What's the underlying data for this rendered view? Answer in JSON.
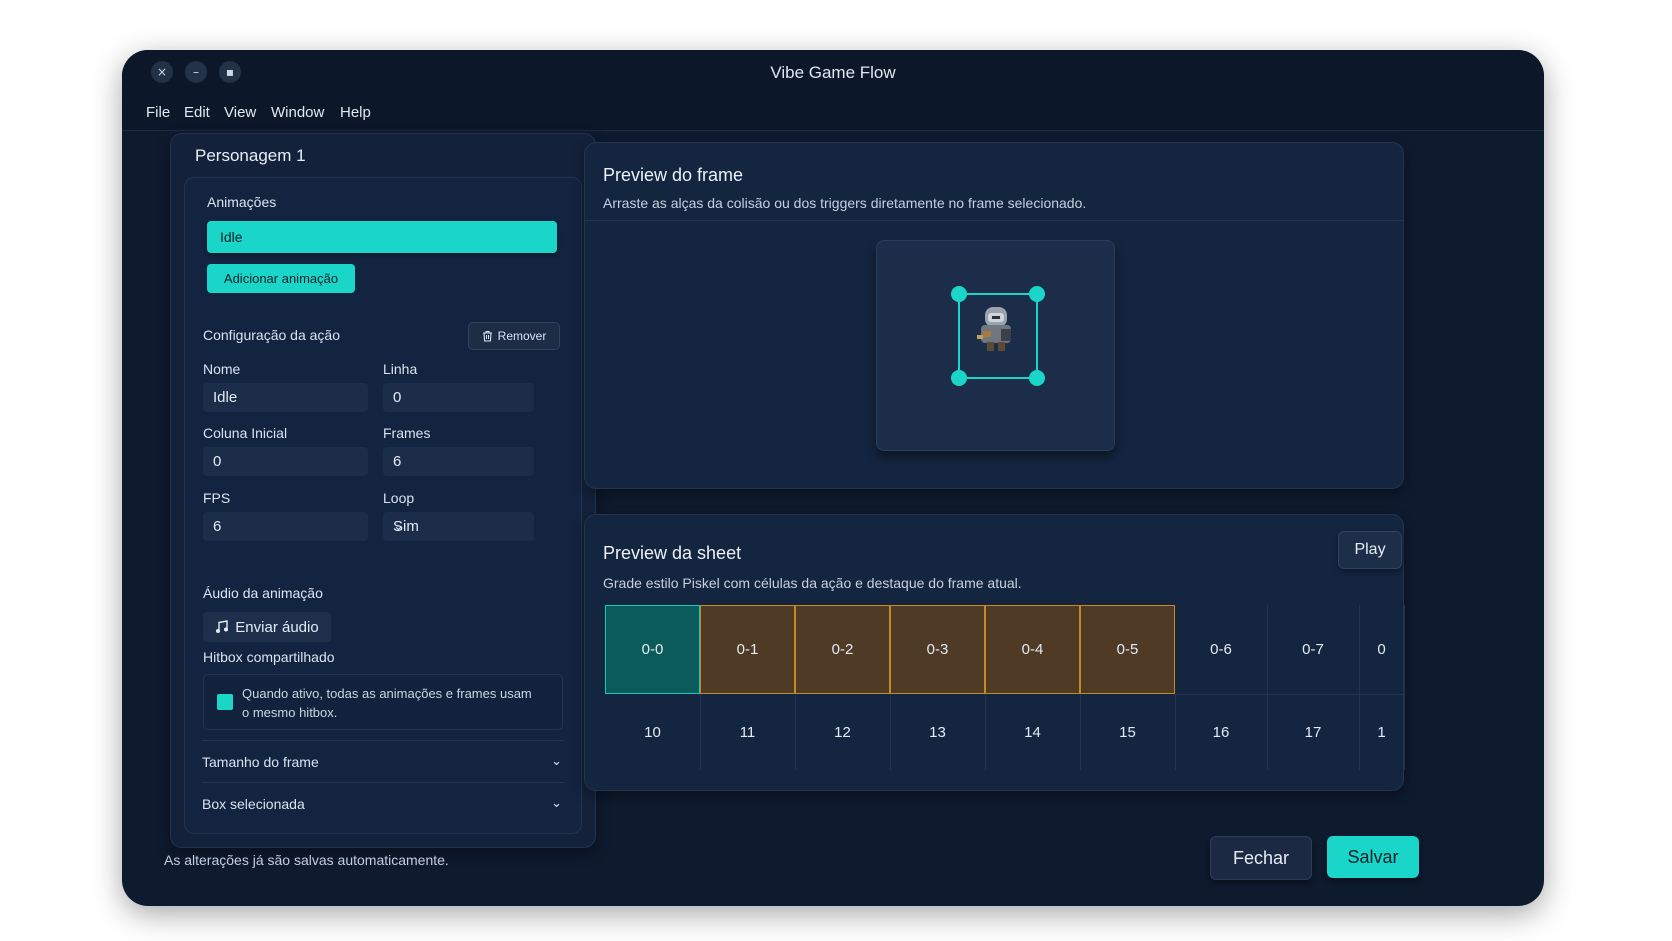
{
  "window": {
    "title": "Vibe Game Flow",
    "controls": [
      "×",
      "–",
      "▪"
    ]
  },
  "menu": [
    "File",
    "Edit",
    "View",
    "Window",
    "Help"
  ],
  "character": {
    "title": "Personagem 1",
    "animations_label": "Animações",
    "animations": [
      "Idle"
    ],
    "add_animation": "Adicionar animação",
    "action_config": "Configuração da ação",
    "remove": "Remover",
    "fields": {
      "nome": {
        "label": "Nome",
        "value": "Idle"
      },
      "linha": {
        "label": "Linha",
        "value": "0"
      },
      "coluna": {
        "label": "Coluna Inicial",
        "value": "0"
      },
      "frames": {
        "label": "Frames",
        "value": "6"
      },
      "fps": {
        "label": "FPS",
        "value": "6"
      },
      "loop": {
        "label": "Loop",
        "value": "Sim"
      }
    },
    "audio_label": "Áudio da animação",
    "audio_button": "Enviar áudio",
    "hitbox_label": "Hitbox compartilhado",
    "hitbox_checked": true,
    "hitbox_text": "Quando ativo, todas as animações e frames usam o mesmo hitbox.",
    "accordions": [
      "Tamanho do frame",
      "Box selecionada"
    ]
  },
  "preview_frame": {
    "title": "Preview do frame",
    "subtitle": "Arraste as alças da colisão ou dos triggers diretamente no frame selecionado."
  },
  "preview_sheet": {
    "title": "Preview da sheet",
    "subtitle": "Grade estilo Piskel com células da ação e destaque do frame atual.",
    "play": "Play",
    "rows": [
      [
        "0-0",
        "0-1",
        "0-2",
        "0-3",
        "0-4",
        "0-5",
        "0-6",
        "0-7",
        "0"
      ],
      [
        "10",
        "11",
        "12",
        "13",
        "14",
        "15",
        "16",
        "17",
        "1"
      ]
    ],
    "current_cell": "0-0",
    "action_cells": [
      "0-1",
      "0-2",
      "0-3",
      "0-4",
      "0-5"
    ]
  },
  "footer": {
    "status": "As alterações já são salvas automaticamente.",
    "close": "Fechar",
    "save": "Salvar"
  },
  "colors": {
    "accent": "#19d6c8",
    "window_bg": "#0e1a2e",
    "panel_bg": "#142540",
    "action_cell": "#4e3a25"
  }
}
